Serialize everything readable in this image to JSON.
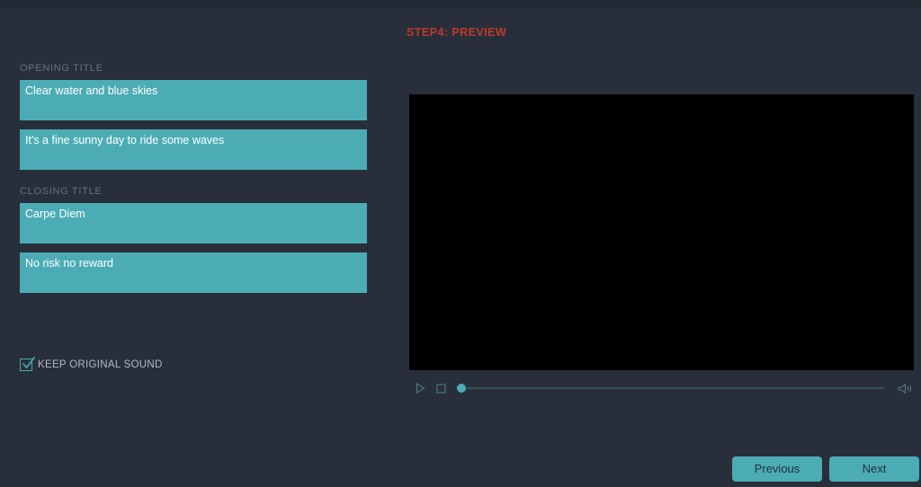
{
  "header": {
    "step_label": "STEP4: PREVIEW",
    "step_color": "#c0392b"
  },
  "left_panel": {
    "opening": {
      "label": "OPENING TITLE",
      "fields": [
        {
          "value": "Clear water and blue skies",
          "placeholder": ""
        },
        {
          "value": "It's a fine sunny day to ride some waves",
          "placeholder": ""
        }
      ]
    },
    "closing": {
      "label": "CLOSING TITLE",
      "fields": [
        {
          "value": "Carpe Diem",
          "placeholder": ""
        },
        {
          "value": "No risk no reward",
          "placeholder": ""
        }
      ]
    },
    "keep_sound": {
      "label": "KEEP ORIGINAL SOUND",
      "checked": true
    }
  },
  "preview": {
    "icons": {
      "play": "play-icon",
      "stop": "stop-icon",
      "volume": "volume-icon"
    },
    "progress_percent": 0
  },
  "footer": {
    "previous_label": "Previous",
    "next_label": "Next"
  },
  "colors": {
    "background": "#282f3a",
    "accent_teal": "#4cacb5",
    "label_muted": "#5e7480",
    "video_black": "#000000"
  }
}
